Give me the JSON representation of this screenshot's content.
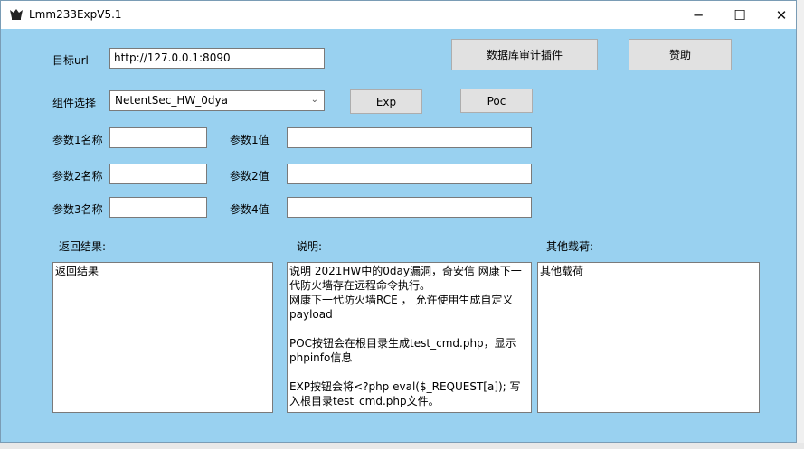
{
  "window": {
    "title": "Lmm233ExpV5.1",
    "minimize": "─",
    "maximize": "☐",
    "close": "✕"
  },
  "form": {
    "target_url_label": "目标url",
    "target_url_value": "http://127.0.0.1:8090",
    "db_audit_button": "数据库审计插件",
    "sponsor_button": "赞助",
    "component_label": "组件选择",
    "component_value": "NetentSec_HW_0dya",
    "exp_button": "Exp",
    "poc_button": "Poc",
    "param1_name_label": "参数1名称",
    "param1_value_label": "参数1值",
    "param2_name_label": "参数2名称",
    "param2_value_label": "参数2值",
    "param3_name_label": "参数3名称",
    "param4_value_label": "参数4值",
    "result_label": "返回结果:",
    "desc_label": "说明:",
    "other_payload_label": "其他载荷:",
    "result_text": "返回结果",
    "desc_text": "说明 2021HW中的0day漏洞，奇安信 网康下一代防火墙存在远程命令执行。\n网康下一代防火墙RCE ， 允许使用生成自定义payload\n\nPOC按钮会在根目录生成test_cmd.php，显示phpinfo信息\n\nEXP按钮会将<?php eval($_REQUEST[a]); 写入根目录test_cmd.php文件。",
    "other_payload_text": "其他载荷"
  }
}
